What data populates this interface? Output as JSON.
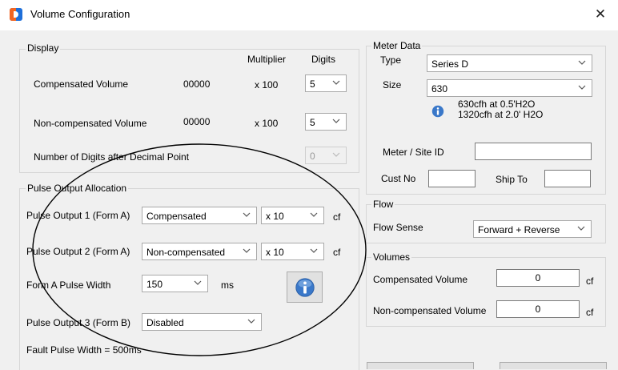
{
  "window": {
    "title": "Volume Configuration",
    "close_glyph": "✕"
  },
  "display": {
    "group_label": "Display",
    "multiplier_header": "Multiplier",
    "digits_header": "Digits",
    "compensated": {
      "label": "Compensated Volume",
      "value": "00000",
      "multiplier": "x 100",
      "digits": "5"
    },
    "noncompensated": {
      "label": "Non-compensated Volume",
      "value": "00000",
      "multiplier": "x 100",
      "digits": "5"
    },
    "decimal": {
      "label": "Number of Digits after Decimal Point",
      "digits": "0"
    }
  },
  "pulse": {
    "group_label": "Pulse Output Allocation",
    "out1": {
      "label": "Pulse Output 1 (Form A)",
      "selection": "Compensated",
      "multiplier": "x 10",
      "unit": "cf"
    },
    "out2": {
      "label": "Pulse Output 2 (Form A)",
      "selection": "Non-compensated",
      "multiplier": "x 10",
      "unit": "cf"
    },
    "width": {
      "label": "Form A Pulse Width",
      "value": "150",
      "unit": "ms"
    },
    "out3": {
      "label": "Pulse Output 3 (Form B)",
      "selection": "Disabled"
    },
    "fault": "Fault Pulse Width = 500ms"
  },
  "meter": {
    "group_label": "Meter Data",
    "type_label": "Type",
    "type_value": "Series D",
    "size_label": "Size",
    "size_value": "630",
    "info_line1": "630cfh at 0.5'H2O",
    "info_line2": "1320cfh at 2.0' H2O",
    "site_id_label": "Meter / Site ID",
    "site_id_value": "",
    "cust_no_label": "Cust No",
    "cust_no_value": "",
    "ship_to_label": "Ship To",
    "ship_to_value": ""
  },
  "flow": {
    "group_label": "Flow",
    "sense_label": "Flow Sense",
    "sense_value": "Forward + Reverse"
  },
  "volumes": {
    "group_label": "Volumes",
    "compensated_label": "Compensated Volume",
    "compensated_value": "0",
    "compensated_unit": "cf",
    "noncompensated_label": "Non-compensated Volume",
    "noncompensated_value": "0",
    "noncompensated_unit": "cf"
  },
  "icons": {
    "app": "app-logo-icon",
    "info": "info-icon",
    "chevron": "chevron-down-icon",
    "close": "close-icon"
  },
  "colors": {
    "info_blue": "#3a78c9",
    "app_blue": "#1e6fd9",
    "app_orange": "#f26522",
    "annotation": "#000000"
  }
}
